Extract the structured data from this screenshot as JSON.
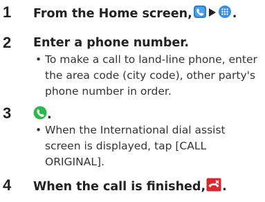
{
  "steps": [
    {
      "number": "1",
      "title_prefix": "From the Home screen, ",
      "title_suffix": ".",
      "icons": [
        "phone-app-icon",
        "arrow-right-icon",
        "dialpad-icon"
      ]
    },
    {
      "number": "2",
      "title": "Enter a phone number.",
      "bullet": "To make a call to land-line phone, enter the area code (city code), other party's phone number in order."
    },
    {
      "number": "3",
      "title_suffix": ".",
      "icons": [
        "call-handset-icon"
      ],
      "bullet": "When the International dial assist screen is displayed, tap [CALL ORIGINAL]."
    },
    {
      "number": "4",
      "title_prefix": "When the call is finished, ",
      "title_suffix": ".",
      "icons": [
        "end-call-icon"
      ]
    }
  ],
  "bullet_char": "•",
  "colors": {
    "text": "#222222",
    "phone_blue": "#2a7fc7",
    "dialpad_blue": "#3b8fe0",
    "call_green": "#2db84a",
    "end_red": "#d9282f"
  }
}
